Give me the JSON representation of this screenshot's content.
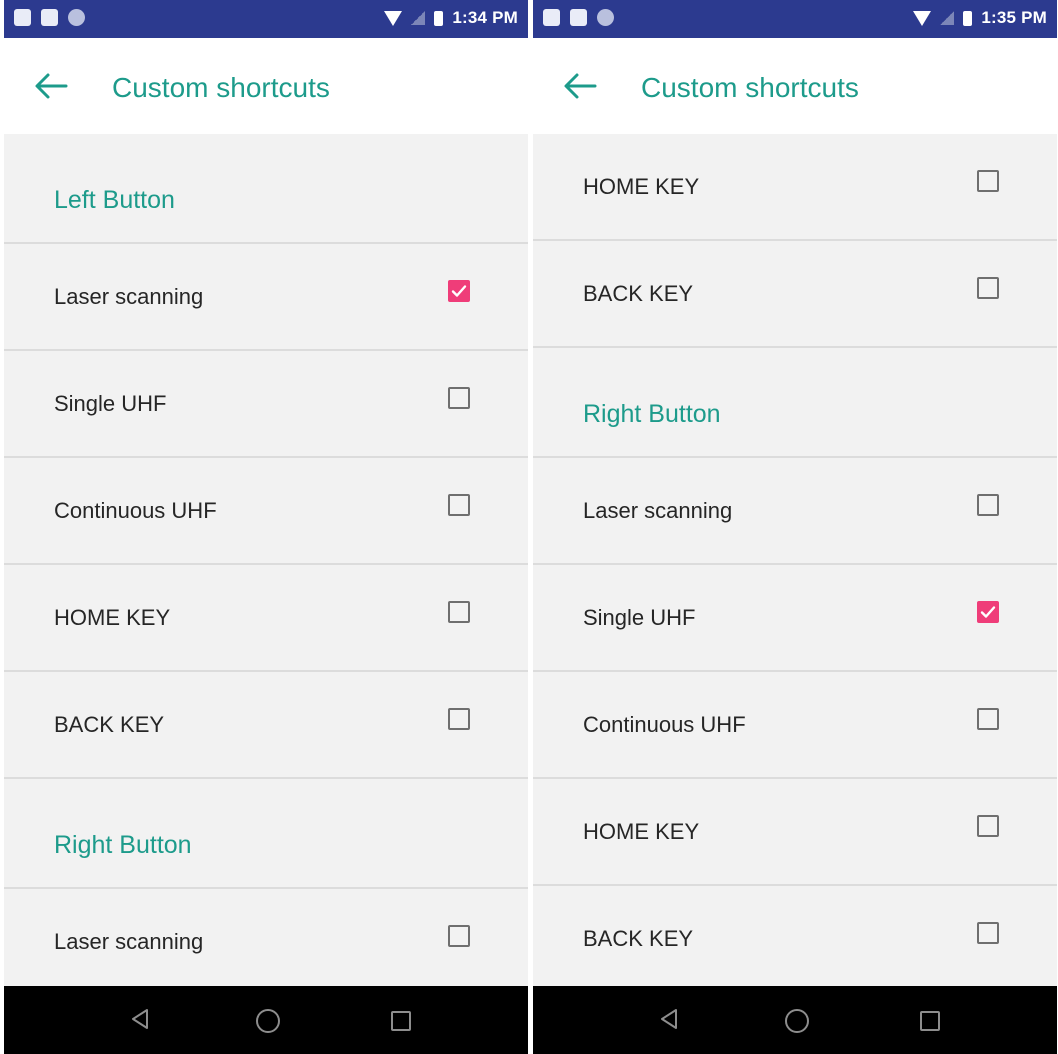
{
  "left_screen": {
    "status_time": "1:34 PM",
    "title": "Custom shortcuts",
    "sections": [
      {
        "label": "Left Button",
        "items": [
          {
            "label": "Laser scanning",
            "checked": true
          },
          {
            "label": "Single UHF",
            "checked": false
          },
          {
            "label": "Continuous UHF",
            "checked": false
          },
          {
            "label": "HOME KEY",
            "checked": false
          },
          {
            "label": "BACK KEY",
            "checked": false
          }
        ]
      },
      {
        "label": "Right Button",
        "items": [
          {
            "label": "Laser scanning",
            "checked": false
          }
        ]
      }
    ]
  },
  "right_screen": {
    "status_time": "1:35 PM",
    "title": "Custom shortcuts",
    "top_items": [
      {
        "label": "HOME KEY",
        "checked": false
      },
      {
        "label": "BACK KEY",
        "checked": false
      }
    ],
    "sections": [
      {
        "label": "Right Button",
        "items": [
          {
            "label": "Laser scanning",
            "checked": false
          },
          {
            "label": "Single UHF",
            "checked": true
          },
          {
            "label": "Continuous UHF",
            "checked": false
          },
          {
            "label": "HOME KEY",
            "checked": false
          },
          {
            "label": "BACK KEY",
            "checked": false
          }
        ]
      }
    ]
  },
  "icons": {
    "status_left": [
      "notification-icon",
      "image-icon",
      "circle-icon"
    ],
    "status_right": [
      "wifi-icon",
      "signal-icon",
      "battery-icon"
    ],
    "appbar": "back-arrow-icon",
    "nav": [
      "nav-back-icon",
      "nav-home-icon",
      "nav-recents-icon"
    ]
  },
  "colors": {
    "status_bar": "#2c3a8f",
    "accent_teal": "#1d9b8b",
    "checkbox_checked": "#ef3d79",
    "background": "#f2f2f2",
    "nav_bar": "#000000"
  }
}
